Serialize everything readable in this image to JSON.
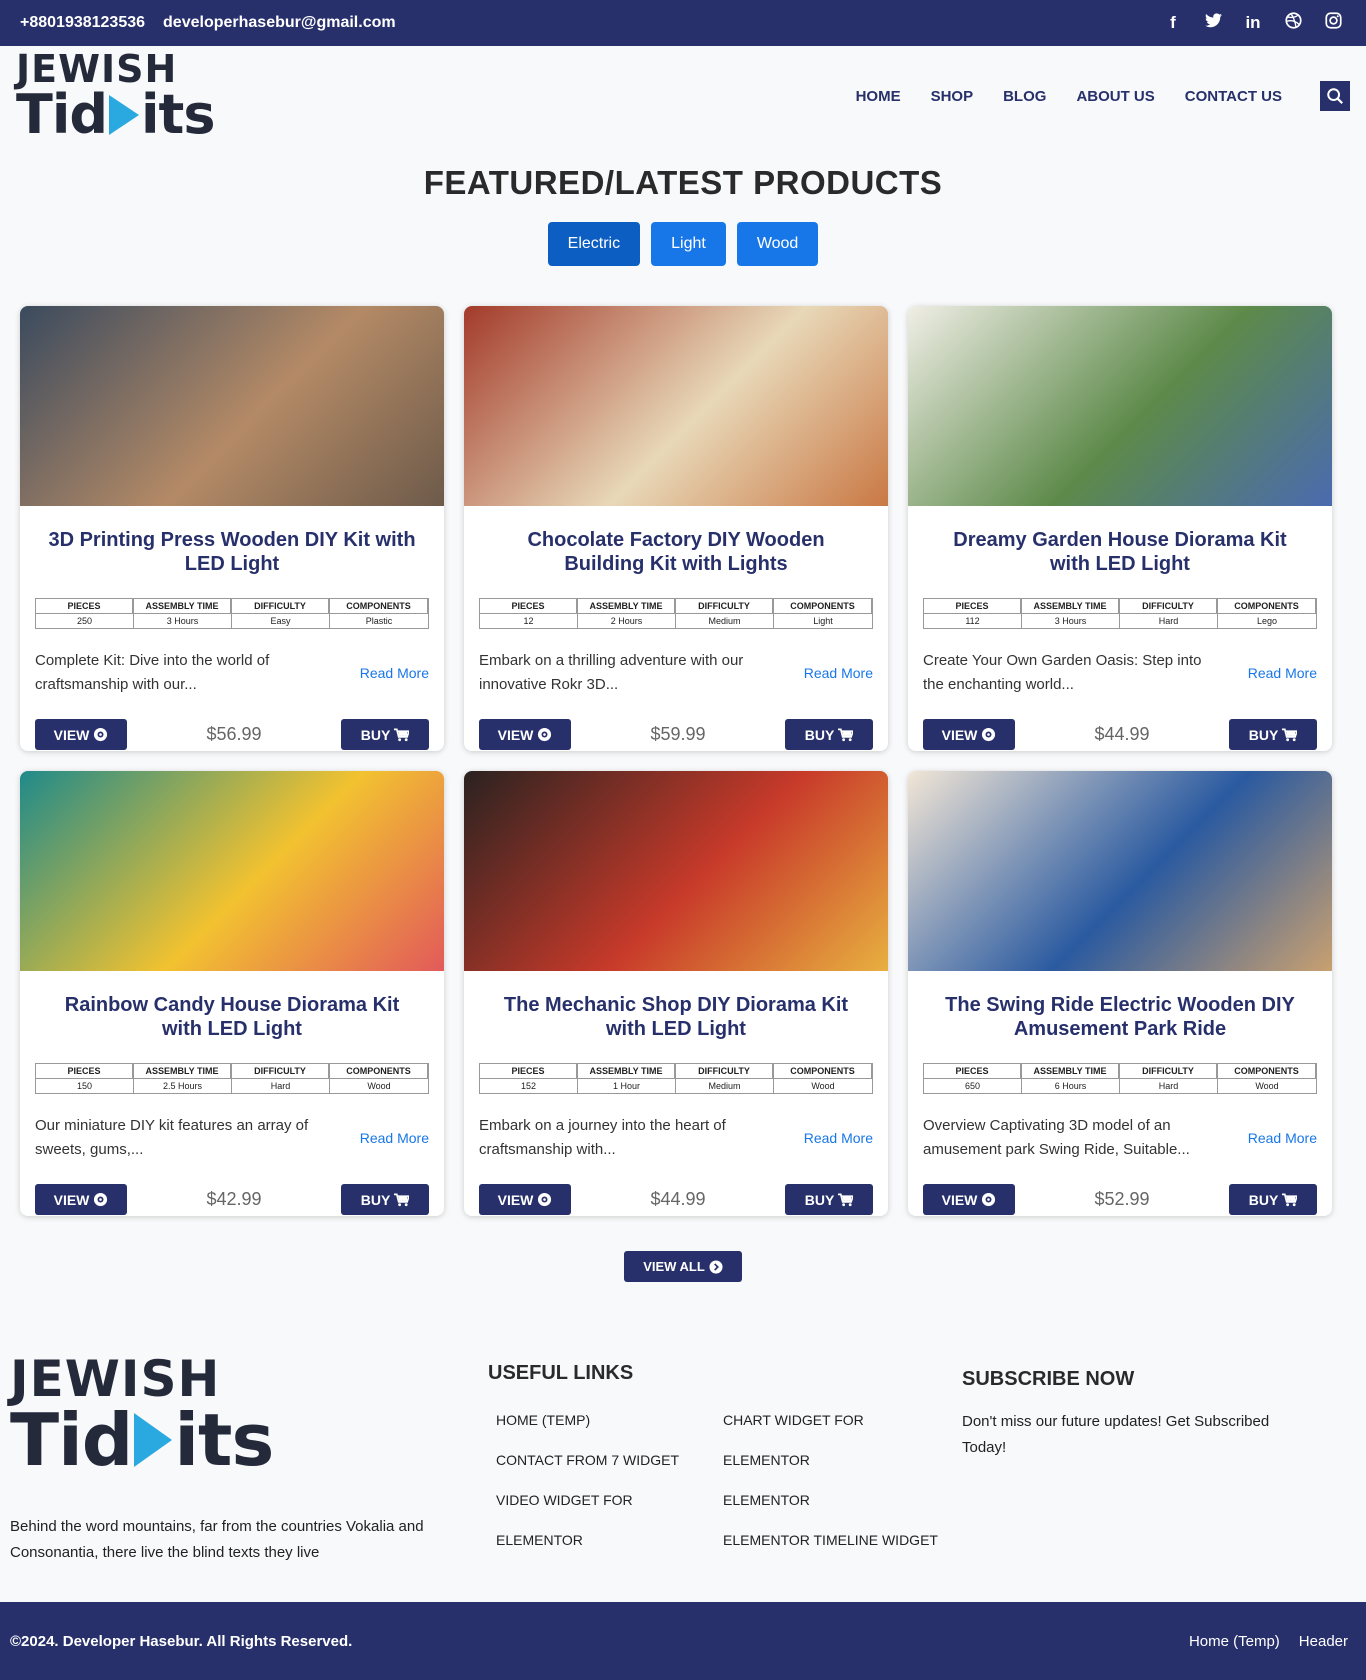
{
  "topbar": {
    "phone": "+8801938123536",
    "email": "developerhasebur@gmail.com",
    "socials": [
      {
        "icon": "facebook-icon",
        "glyph": "f"
      },
      {
        "icon": "twitter-icon",
        "glyph": "t"
      },
      {
        "icon": "linkedin-icon",
        "glyph": "in"
      },
      {
        "icon": "dribbble-icon",
        "glyph": "◎"
      },
      {
        "icon": "instagram-icon",
        "glyph": "◻"
      }
    ]
  },
  "brand": {
    "line1": "JEWISH",
    "line2a": "Tid",
    "line2b": "its"
  },
  "nav": [
    "HOME",
    "SHOP",
    "BLOG",
    "ABOUT US",
    "CONTACT US"
  ],
  "section_title": "FEATURED/LATEST PRODUCTS",
  "filters": [
    "Electric",
    "Light",
    "Wood"
  ],
  "spec_headers": [
    "PIECES",
    "ASSEMBLY TIME",
    "DIFFICULTY",
    "COMPONENTS"
  ],
  "products": [
    {
      "title": "3D Printing Press Wooden DIY Kit with LED Light",
      "specs": [
        "250",
        "3 Hours",
        "Easy",
        "Plastic"
      ],
      "desc": "Complete Kit: Dive into the world of craftsmanship with our...",
      "price": "$56.99",
      "colors": [
        "#3a4a5e",
        "#b48a66",
        "#6d5a4a"
      ]
    },
    {
      "title": "Chocolate Factory DIY Wooden Building Kit with Lights",
      "specs": [
        "12",
        "2 Hours",
        "Medium",
        "Light"
      ],
      "desc": "Embark on a thrilling adventure with our innovative Rokr 3D...",
      "price": "$59.99",
      "colors": [
        "#a33a2a",
        "#e8d8b8",
        "#c97844"
      ]
    },
    {
      "title": "Dreamy Garden House Diorama Kit with LED Light",
      "specs": [
        "112",
        "3 Hours",
        "Hard",
        "Lego"
      ],
      "desc": "Create Your Own Garden Oasis: Step into the enchanting world...",
      "price": "$44.99",
      "colors": [
        "#f0eee6",
        "#5d8a4a",
        "#4a6ab0"
      ]
    },
    {
      "title": "Rainbow Candy House Diorama Kit with LED Light",
      "specs": [
        "150",
        "2.5 Hours",
        "Hard",
        "Wood"
      ],
      "desc": "Our miniature DIY kit features an array of sweets, gums,...",
      "price": "$42.99",
      "colors": [
        "#1f8a8a",
        "#f2c230",
        "#e25a5a"
      ]
    },
    {
      "title": "The Mechanic Shop DIY Diorama Kit with LED Light",
      "specs": [
        "152",
        "1 Hour",
        "Medium",
        "Wood"
      ],
      "desc": "Embark on a journey into the heart of craftsmanship with...",
      "price": "$44.99",
      "colors": [
        "#2a2220",
        "#c83a2a",
        "#e8b040"
      ]
    },
    {
      "title": "The Swing Ride Electric Wooden DIY Amusement Park Ride",
      "specs": [
        "650",
        "6 Hours",
        "Hard",
        "Wood"
      ],
      "desc": "Overview Captivating 3D model of an amusement park Swing Ride, Suitable...",
      "price": "$52.99",
      "colors": [
        "#f2e6d6",
        "#2a5aa0",
        "#c9a070"
      ]
    }
  ],
  "card_labels": {
    "read_more": "Read More",
    "view": "VIEW",
    "buy": "BUY"
  },
  "view_all": "VIEW ALL",
  "footer": {
    "about": "Behind the word mountains, far from the countries Vokalia and Consonantia, there live the blind texts they live",
    "useful_title": "USEFUL LINKS",
    "links": [
      "HOME (TEMP)",
      "CHART WIDGET FOR",
      "CONTACT FROM 7 WIDGET",
      "ELEMENTOR",
      "VIDEO WIDGET FOR",
      "ELEMENTOR",
      "ELEMENTOR",
      "ELEMENTOR TIMELINE WIDGET"
    ],
    "subscribe_title": "SUBSCRIBE NOW",
    "subscribe_text": "Don't miss our future updates! Get Subscribed Today!"
  },
  "bottombar": {
    "copyright": "©2024. Developer Hasebur. All Rights Reserved.",
    "links": [
      "Home (Temp)",
      "Header"
    ]
  },
  "colors": {
    "navy": "#27306b",
    "accent_blue": "#1877e8",
    "logo_play": "#2aa9e0"
  }
}
